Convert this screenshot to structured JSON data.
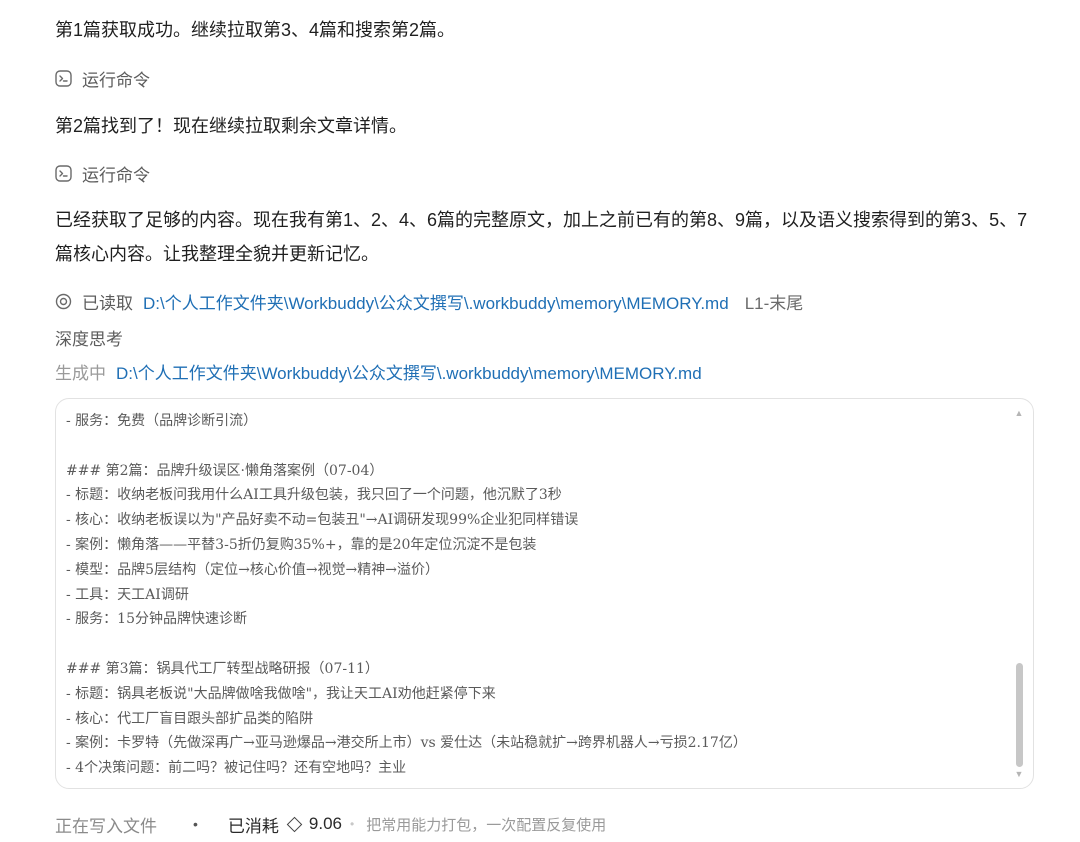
{
  "messages": {
    "p1": "第1篇获取成功。继续拉取第3、4篇和搜索第2篇。",
    "p2": "第2篇找到了！现在继续拉取剩余文章详情。",
    "p3": "已经获取了足够的内容。现在我有第1、2、4、6篇的完整原文，加上之前已有的第8、9篇，以及语义搜索得到的第3、5、7篇核心内容。让我整理全貌并更新记忆。"
  },
  "tools": {
    "run1": {
      "label": "运行命令",
      "icon": "terminal-icon"
    },
    "run2": {
      "label": "运行命令",
      "icon": "terminal-icon"
    },
    "read": {
      "label": "已读取",
      "path": "D:\\个人工作文件夹\\Workbuddy\\公众文撰写\\.workbuddy\\memory\\MEMORY.md",
      "range": "L1-末尾",
      "icon": "eye-icon"
    },
    "think": {
      "label": "深度思考"
    },
    "generate": {
      "label": "生成中",
      "path": "D:\\个人工作文件夹\\Workbuddy\\公众文撰写\\.workbuddy\\memory\\MEMORY.md"
    }
  },
  "code": {
    "lines": [
      "- 服务：免费（品牌诊断引流）",
      "",
      "### 第2篇：品牌升级误区·懒角落案例（07-04）",
      "- 标题：收纳老板问我用什么AI工具升级包装，我只回了一个问题，他沉默了3秒",
      "- 核心：收纳老板误以为\"产品好卖不动=包装丑\"→AI调研发现99%企业犯同样错误",
      "- 案例：懒角落——平替3-5折仍复购35%+，靠的是20年定位沉淀不是包装",
      "- 模型：品牌5层结构（定位→核心价值→视觉→精神→溢价）",
      "- 工具：天工AI调研",
      "- 服务：15分钟品牌快速诊断",
      "",
      "### 第3篇：锅具代工厂转型战略研报（07-11）",
      "- 标题：锅具老板说\"大品牌做啥我做啥\"，我让天工AI劝他赶紧停下来",
      "- 核心：代工厂盲目跟头部扩品类的陷阱",
      "- 案例：卡罗特（先做深再广→亚马逊爆品→港交所上市）vs 爱仕达（未站稳就扩→跨界机器人→亏损2.17亿）",
      "- 4个决策问题：前二吗？被记住吗？还有空地吗？主业"
    ]
  },
  "status": {
    "writing": "正在写入文件",
    "consumed_label": "已消耗",
    "consumed_value": "9.06",
    "tip": "把常用能力打包，一次配置反复使用"
  }
}
